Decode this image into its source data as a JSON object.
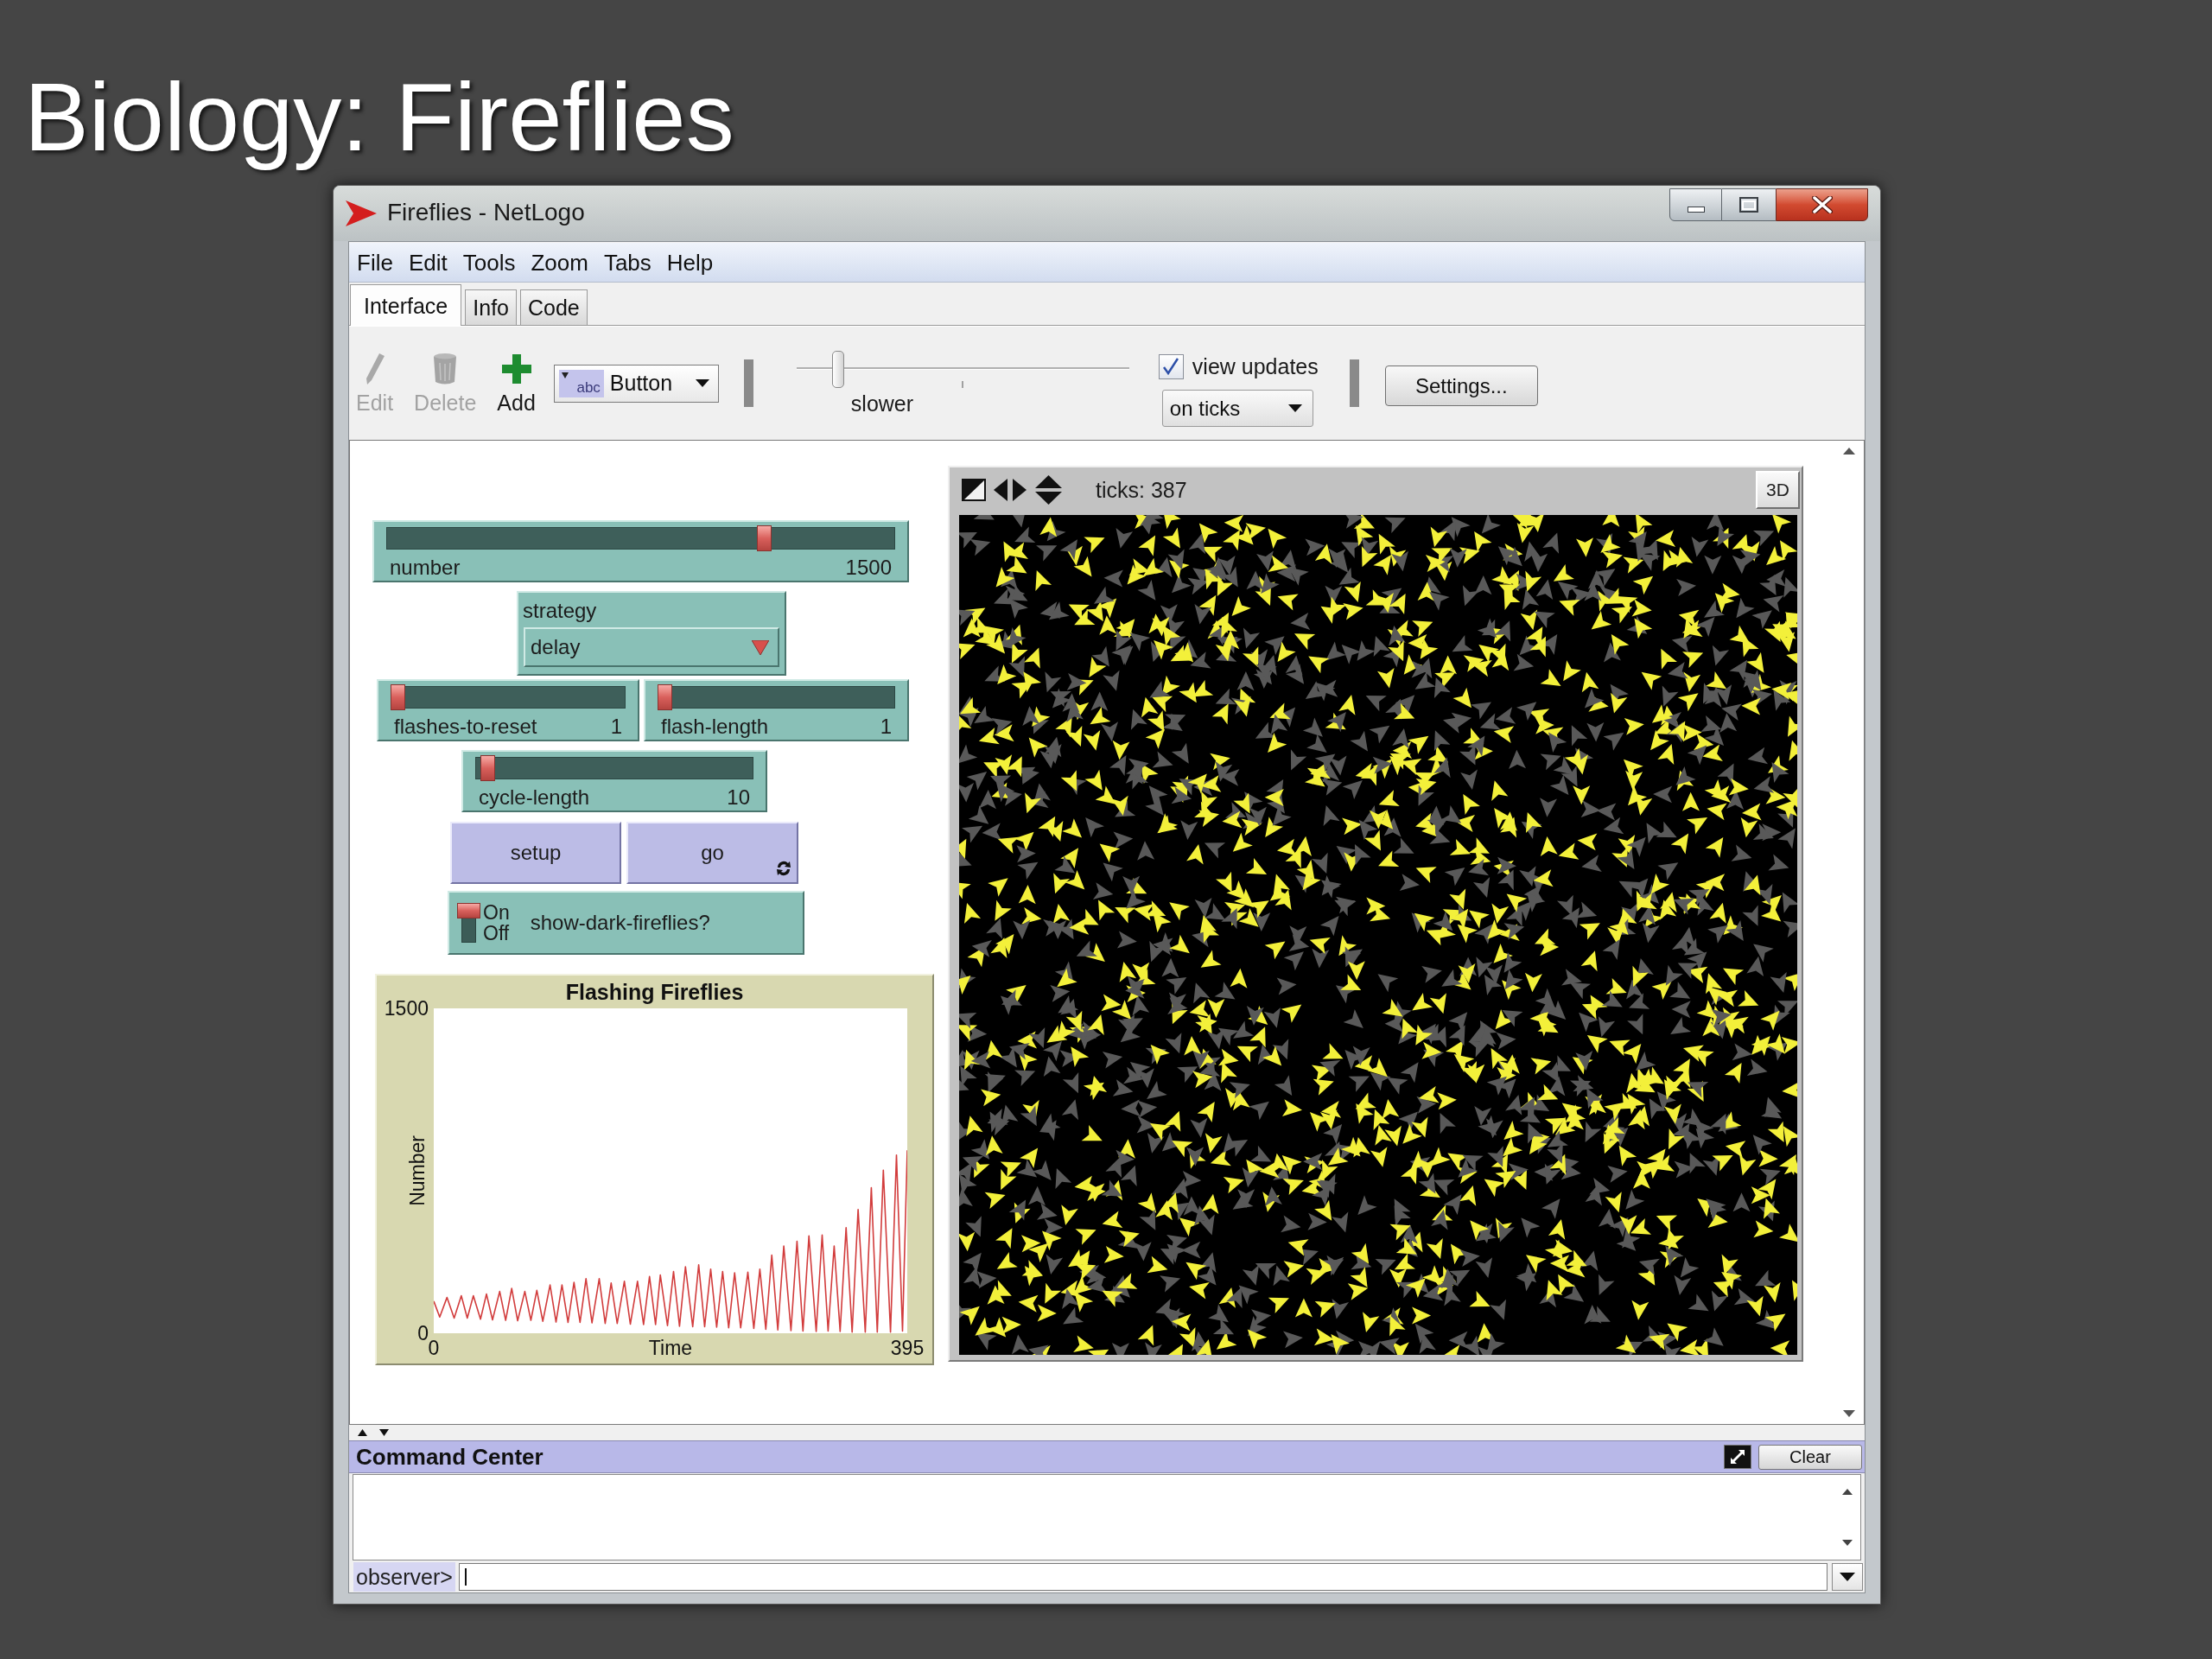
{
  "slide": {
    "title": "Biology: Fireflies"
  },
  "window": {
    "title": "Fireflies - NetLogo"
  },
  "menu": [
    "File",
    "Edit",
    "Tools",
    "Zoom",
    "Tabs",
    "Help"
  ],
  "tabs": [
    {
      "label": "Interface",
      "selected": true
    },
    {
      "label": "Info",
      "selected": false
    },
    {
      "label": "Code",
      "selected": false
    }
  ],
  "toolbar": {
    "tools": [
      {
        "kind": "pencil",
        "label": "Edit",
        "disabled": true
      },
      {
        "kind": "trash",
        "label": "Delete",
        "disabled": true
      },
      {
        "kind": "plus",
        "label": "Add",
        "disabled": false
      }
    ],
    "widget_type": {
      "icon_text": "abc",
      "label": "Button"
    },
    "speed": {
      "label": "slower",
      "level": 0.11
    },
    "view_updates": {
      "label": "view updates",
      "checked": true
    },
    "update_mode": "on ticks",
    "settings_button": "Settings..."
  },
  "widgets": [
    {
      "kind": "slider",
      "label": "number",
      "value": "1500",
      "level": 0.75
    },
    {
      "kind": "chooser",
      "label": "strategy",
      "value": "delay"
    },
    {
      "kind": "slider",
      "label": "flashes-to-reset",
      "value": "1",
      "level": 0
    },
    {
      "kind": "slider",
      "label": "flash-length",
      "value": "1",
      "level": 0
    },
    {
      "kind": "slider",
      "label": "cycle-length",
      "value": "10",
      "level": 0.02
    },
    {
      "kind": "button",
      "label": "setup",
      "forever": false
    },
    {
      "kind": "button",
      "label": "go",
      "forever": true
    },
    {
      "kind": "switch",
      "label": "show-dark-fireflies?",
      "on_label": "On",
      "off_label": "Off",
      "on": true
    }
  ],
  "plot": {
    "chart_data": {
      "type": "line",
      "title": "Flashing Fireflies",
      "xlabel": "Time",
      "ylabel": "Number",
      "x": [
        0,
        5,
        11,
        17,
        23,
        28,
        33,
        39,
        44,
        49,
        55,
        60,
        65,
        70,
        76,
        81,
        86,
        91,
        97,
        102,
        107,
        112,
        117,
        122,
        127,
        132,
        138,
        143,
        148,
        153,
        159,
        164,
        170,
        175,
        180,
        185,
        189,
        195,
        200,
        205,
        210,
        216,
        221,
        226,
        231,
        236,
        241,
        246,
        251,
        256,
        262,
        267,
        272,
        277,
        282,
        287,
        292,
        298,
        303,
        308,
        313,
        319,
        324,
        329,
        334,
        339,
        344,
        349,
        354,
        360,
        365,
        370,
        375,
        381,
        386,
        391,
        395
      ],
      "series": [
        {
          "color": "#d23c3c",
          "values": [
            148,
            75,
            165,
            70,
            173,
            70,
            173,
            65,
            181,
            62,
            193,
            60,
            207,
            58,
            193,
            60,
            198,
            55,
            223,
            52,
            223,
            50,
            235,
            50,
            252,
            48,
            252,
            45,
            232,
            45,
            240,
            42,
            240,
            40,
            262,
            40,
            269,
            35,
            285,
            32,
            307,
            30,
            316,
            30,
            296,
            28,
            285,
            25,
            279,
            25,
            282,
            22,
            296,
            18,
            361,
            15,
            403,
            12,
            425,
            10,
            450,
            8,
            454,
            10,
            403,
            8,
            487,
            5,
            571,
            5,
            672,
            5,
            753,
            5,
            823,
            10,
            845
          ]
        }
      ],
      "xlim": [
        0,
        395
      ],
      "ylim": [
        0,
        1500
      ],
      "xticks": [
        0,
        395
      ],
      "yticks": [
        0,
        1500
      ]
    }
  },
  "view": {
    "ticks": "ticks: 387",
    "button_3d": "3D"
  },
  "command_center": {
    "title": "Command Center",
    "clear_button": "Clear",
    "prompt": "observer>"
  }
}
